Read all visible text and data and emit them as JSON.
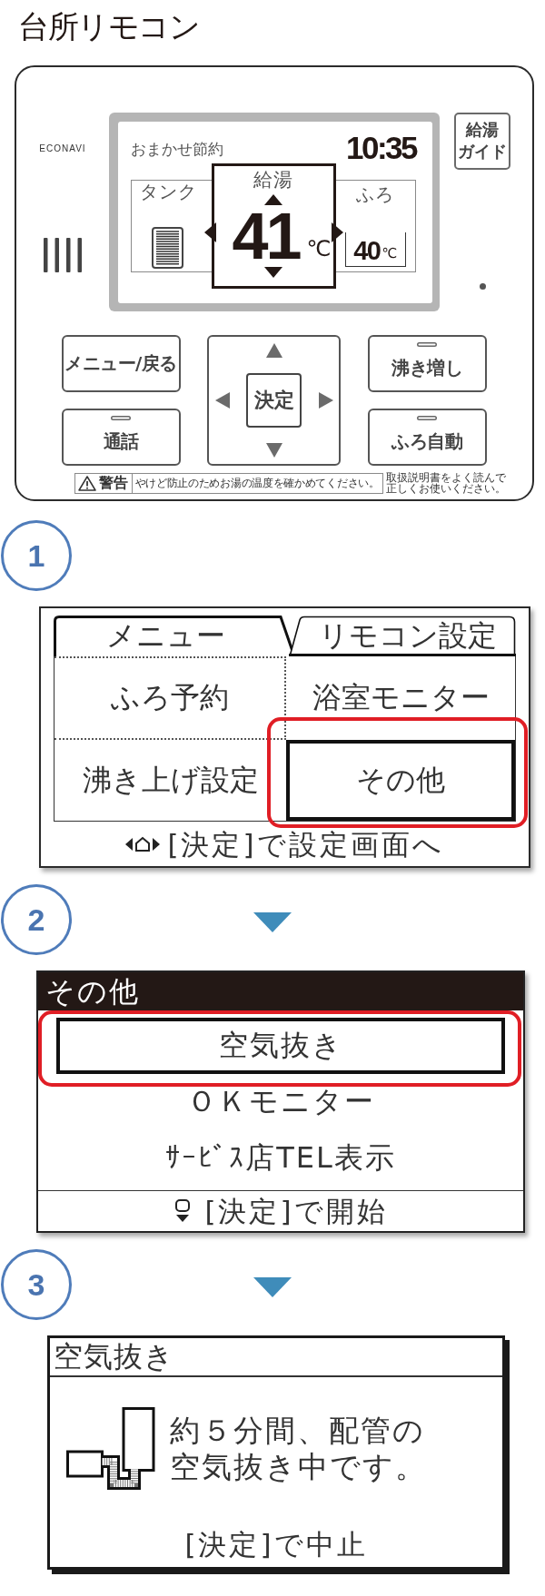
{
  "title": "台所リモコン",
  "remote": {
    "brand": "ECONAVI",
    "display": {
      "mode": "おまかせ節約",
      "time": "10:35",
      "tank": {
        "label": "タンク"
      },
      "hot_water": {
        "label": "給湯",
        "temperature": "41",
        "unit": "℃"
      },
      "bath": {
        "label": "ふろ",
        "temperature": "40",
        "unit": "℃"
      }
    },
    "guide_button": {
      "lines": [
        "給湯",
        "ガイド"
      ]
    },
    "left_buttons": [
      {
        "label": "メニュー/戻る",
        "indicator": false
      },
      {
        "label": "通話",
        "indicator": true
      }
    ],
    "dpad": {
      "center": "決定"
    },
    "right_buttons": [
      {
        "label": "沸き増し",
        "indicator": true
      },
      {
        "label": "ふろ自動",
        "indicator": true
      }
    ],
    "warning": {
      "label": "警告",
      "text": "やけど防止のためお湯の温度を確かめてください。",
      "note_lines": [
        "取扱説明書をよく読んで",
        "正しくお使いください。"
      ]
    }
  },
  "steps": [
    {
      "number": "1",
      "arrow_above": false,
      "screen": {
        "kind": "tabbed_menu",
        "tabs": [
          {
            "label": "メニュー",
            "selected": true
          },
          {
            "label": "リモコン設定",
            "selected": false
          }
        ],
        "items": [
          {
            "label": "ふろ予約",
            "selected": false,
            "highlighted": false
          },
          {
            "label": "浴室モニター",
            "selected": false,
            "highlighted": false
          },
          {
            "label": "沸き上げ設定",
            "selected": false,
            "highlighted": false
          },
          {
            "label": "その他",
            "selected": true,
            "highlighted": true
          }
        ],
        "footer": "[決定]で設定画面へ"
      }
    },
    {
      "number": "2",
      "arrow_above": true,
      "screen": {
        "kind": "list",
        "title": "その他",
        "items": [
          {
            "label": "空気抜き",
            "selected": true,
            "highlighted": true
          },
          {
            "label": "ＯＫモニター",
            "selected": false,
            "highlighted": false
          },
          {
            "label": "ｻｰﾋﾞｽ店TEL表示",
            "selected": false,
            "highlighted": false
          }
        ],
        "footer": "[決定]で開始"
      }
    },
    {
      "number": "3",
      "arrow_above": true,
      "screen": {
        "kind": "message",
        "title": "空気抜き",
        "message_lines": [
          "約５分間、配管の",
          "空気抜き中です。"
        ],
        "footer": "[決定]で中止"
      }
    }
  ]
}
